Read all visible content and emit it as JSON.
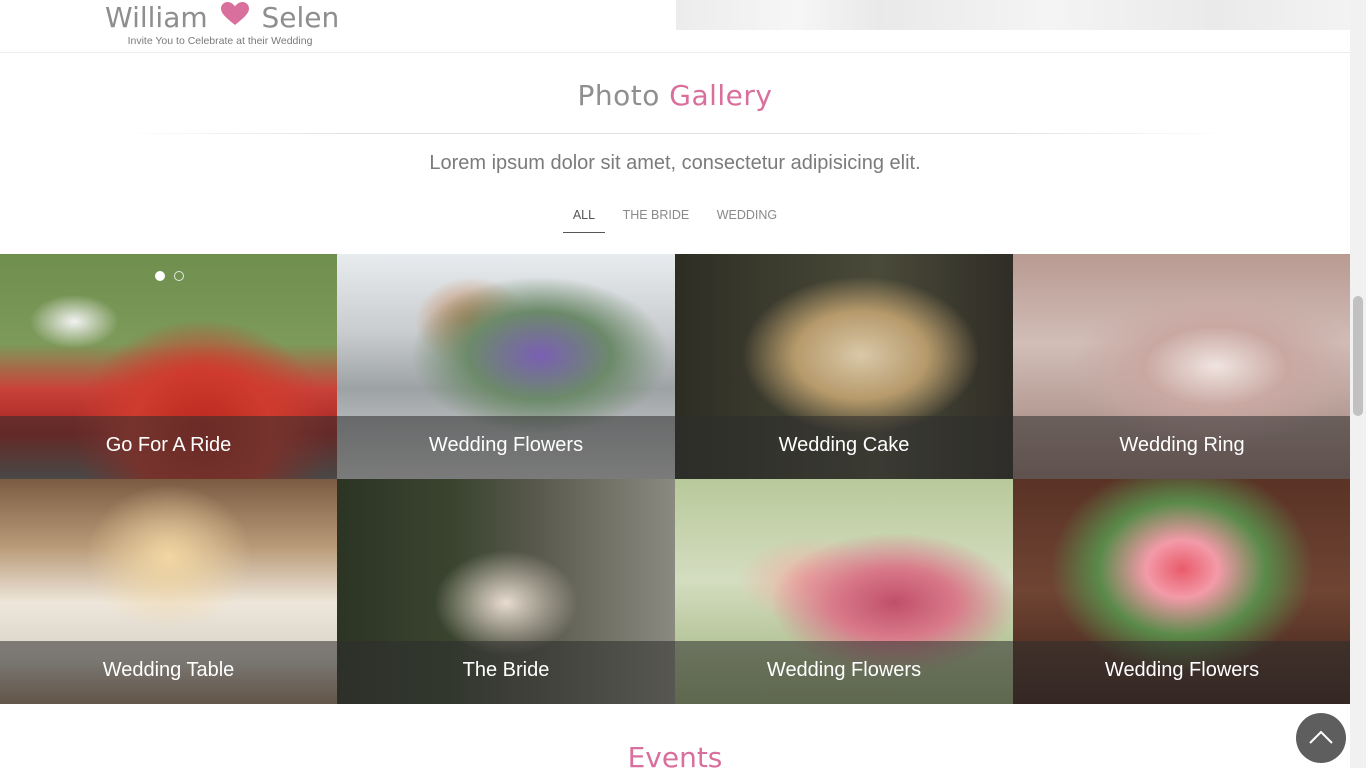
{
  "header": {
    "name1": "William",
    "name2": "Selen",
    "tagline": "Invite You to Celebrate at their Wedding",
    "heart_icon": "heart-icon"
  },
  "gallery": {
    "title_part1": "Photo",
    "title_part2": "Gallery",
    "subtitle": "Lorem ipsum dolor sit amet, consectetur adipisicing elit.",
    "filters": [
      "ALL",
      "THE BRIDE",
      "WEDDING"
    ],
    "active_filter": "ALL",
    "tiles": [
      {
        "caption": "Go For A Ride"
      },
      {
        "caption": "Wedding Flowers"
      },
      {
        "caption": "Wedding Cake"
      },
      {
        "caption": "Wedding Ring"
      },
      {
        "caption": "Wedding Table"
      },
      {
        "caption": "The Bride"
      },
      {
        "caption": "Wedding Flowers"
      },
      {
        "caption": "Wedding Flowers"
      }
    ]
  },
  "events": {
    "title": "Events"
  },
  "scroll_top": {
    "icon": "chevron-up-icon"
  },
  "colors": {
    "accent": "#d96f9c",
    "heading_gray": "#8f8f8f",
    "caption_overlay": "#2d2d2d"
  }
}
